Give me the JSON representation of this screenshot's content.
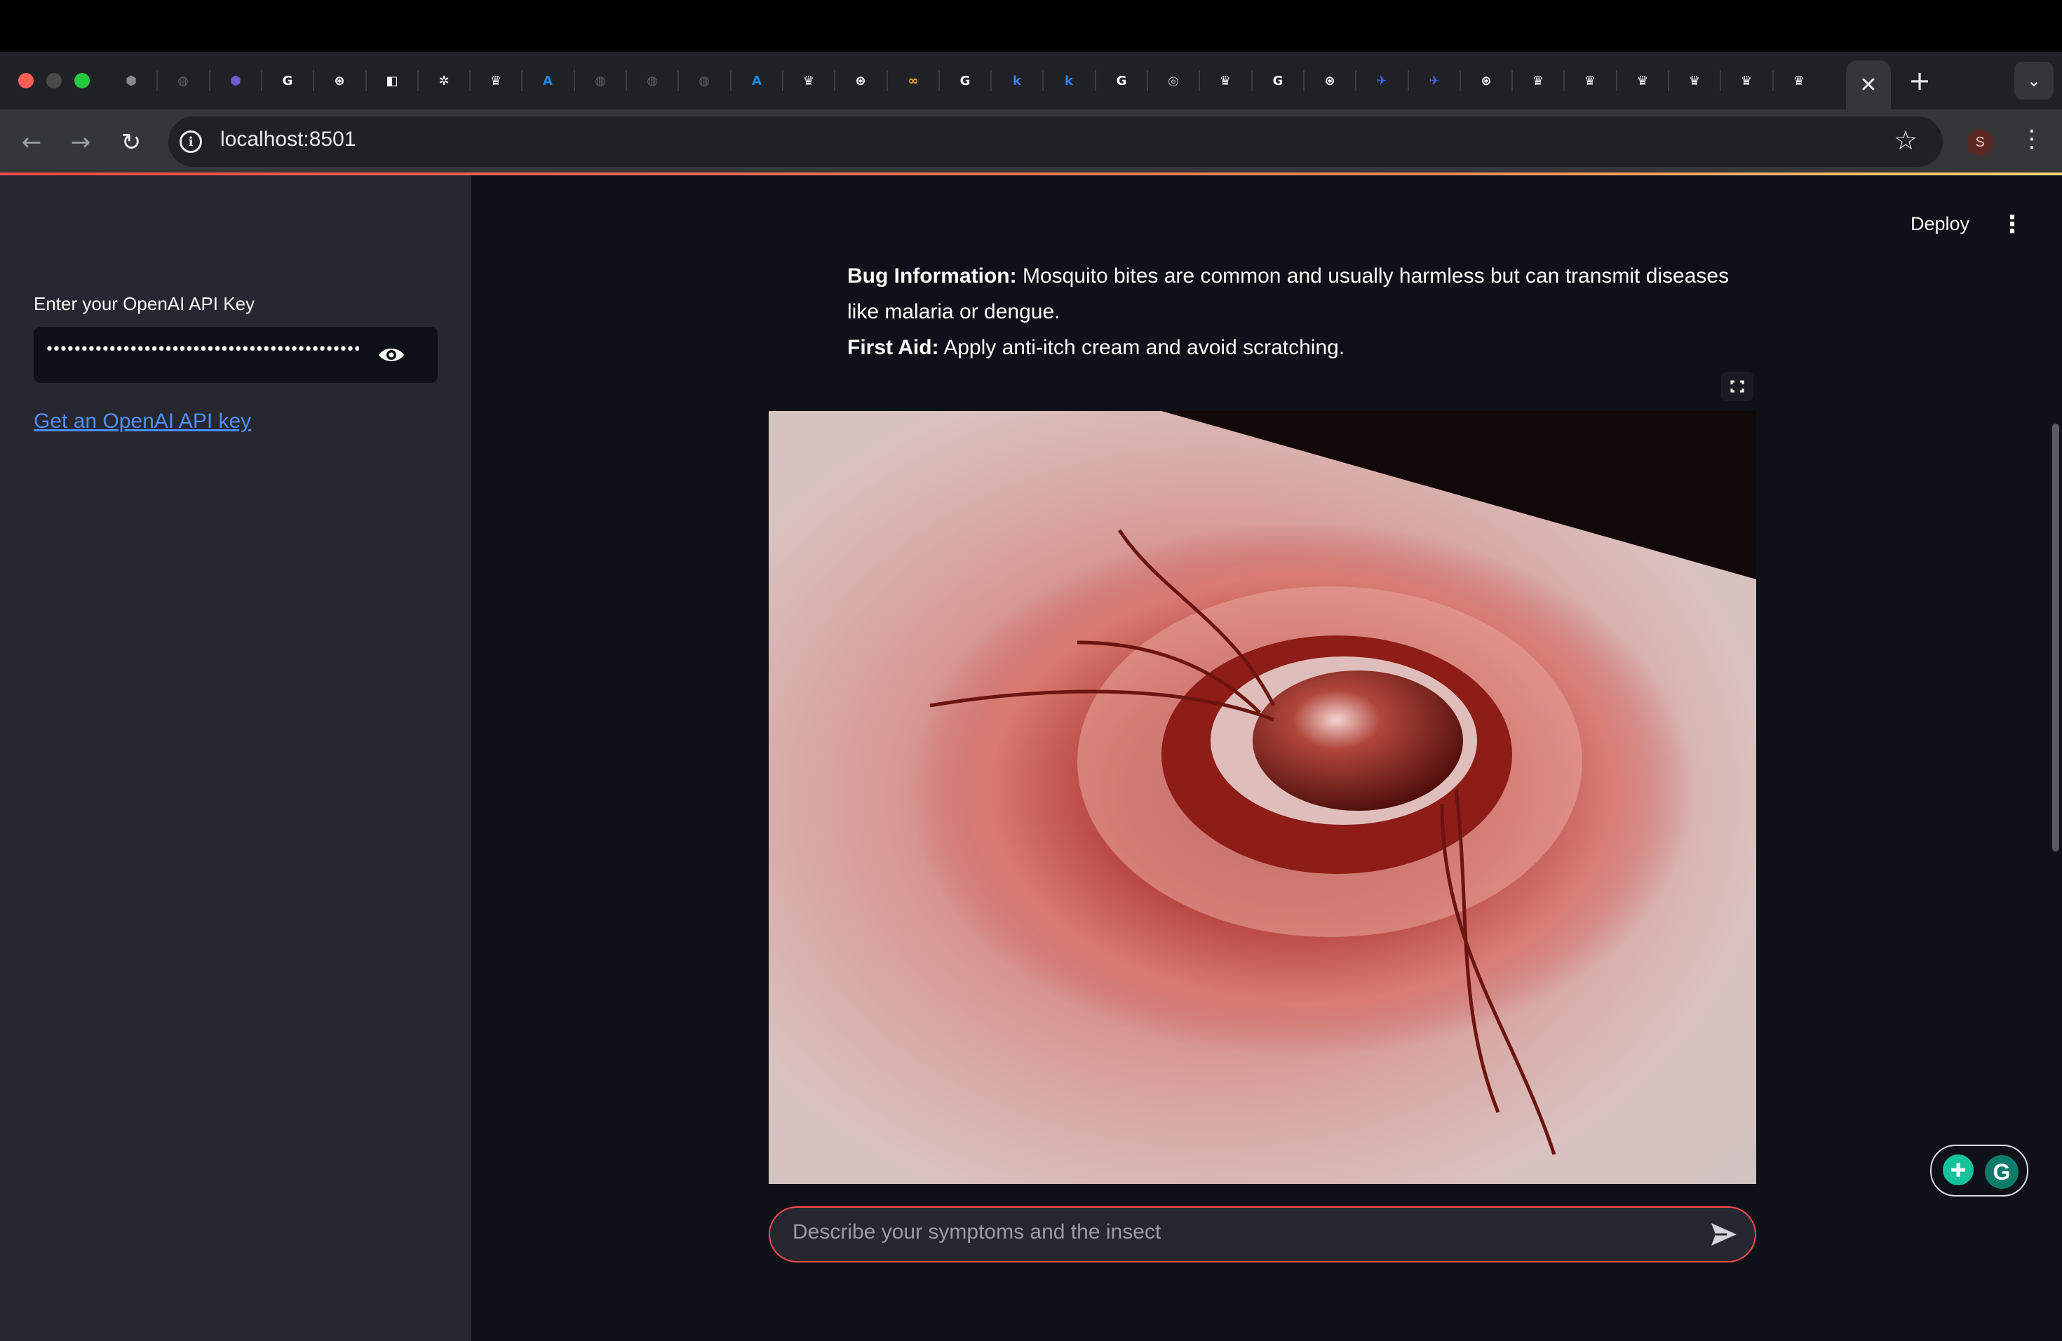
{
  "browser": {
    "url": "localhost:8501",
    "active_tab_close": "✕",
    "new_tab": "+",
    "tab_menu": "⌄",
    "profile_initial": "S",
    "back": "←",
    "forward": "→",
    "reload": "↻",
    "info": "i",
    "star": "☆",
    "menu": "⋮",
    "tabs": [
      {
        "icon": "hub-icon",
        "glyph": "⬢",
        "color": "#8a8a8a"
      },
      {
        "icon": "globe-icon",
        "glyph": "◍",
        "color": "#5f6368"
      },
      {
        "icon": "shield-icon",
        "glyph": "⬢",
        "color": "#6d5bd0"
      },
      {
        "icon": "google-icon",
        "glyph": "G",
        "color": "#ffffff"
      },
      {
        "icon": "openai-icon",
        "glyph": "⊛",
        "color": "#ffffff"
      },
      {
        "icon": "notion-icon",
        "glyph": "◧",
        "color": "#ffffff"
      },
      {
        "icon": "bug-icon",
        "glyph": "✲",
        "color": "#ffffff"
      },
      {
        "icon": "emblem-icon",
        "glyph": "♛",
        "color": "#ffffff"
      },
      {
        "icon": "a-icon",
        "glyph": "A",
        "color": "#1e88e5"
      },
      {
        "icon": "globe-icon",
        "glyph": "◍",
        "color": "#5f6368"
      },
      {
        "icon": "globe-icon",
        "glyph": "◍",
        "color": "#5f6368"
      },
      {
        "icon": "globe-icon",
        "glyph": "◍",
        "color": "#5f6368"
      },
      {
        "icon": "a-icon",
        "glyph": "A",
        "color": "#1e88e5"
      },
      {
        "icon": "crown-icon",
        "glyph": "♛",
        "color": "#ffffff"
      },
      {
        "icon": "openai-icon",
        "glyph": "⊛",
        "color": "#ffffff"
      },
      {
        "icon": "infinity-icon",
        "glyph": "∞",
        "color": "#f5a623"
      },
      {
        "icon": "google-icon",
        "glyph": "G",
        "color": "#ffffff"
      },
      {
        "icon": "k-icon",
        "glyph": "k",
        "color": "#2f80ed"
      },
      {
        "icon": "k-icon",
        "glyph": "k",
        "color": "#2f80ed"
      },
      {
        "icon": "google-icon",
        "glyph": "G",
        "color": "#ffffff"
      },
      {
        "icon": "chrome-icon",
        "glyph": "◎",
        "color": "#bdbdbd"
      },
      {
        "icon": "crown-icon",
        "glyph": "♛",
        "color": "#ffffff"
      },
      {
        "icon": "google-icon",
        "glyph": "G",
        "color": "#ffffff"
      },
      {
        "icon": "openai-icon",
        "glyph": "⊛",
        "color": "#ffffff"
      },
      {
        "icon": "whale-icon",
        "glyph": "✈",
        "color": "#4466ff"
      },
      {
        "icon": "whale-icon",
        "glyph": "✈",
        "color": "#4466ff"
      },
      {
        "icon": "openai-icon",
        "glyph": "⊛",
        "color": "#ffffff"
      },
      {
        "icon": "crown-icon",
        "glyph": "♛",
        "color": "#ffffff"
      },
      {
        "icon": "crown-icon",
        "glyph": "♛",
        "color": "#ffffff"
      },
      {
        "icon": "crown-icon",
        "glyph": "♛",
        "color": "#ffffff"
      },
      {
        "icon": "crown-icon",
        "glyph": "♛",
        "color": "#ffffff"
      },
      {
        "icon": "crown-icon",
        "glyph": "♛",
        "color": "#ffffff"
      },
      {
        "icon": "crown-icon",
        "glyph": "♛",
        "color": "#ffffff"
      }
    ]
  },
  "sidebar": {
    "api_key_label": "Enter your OpenAI API Key",
    "api_key_value": "•••••••••••••••••••••••••••••••••••••••••••••••••••••••",
    "api_key_link": "Get an OpenAI API key"
  },
  "header": {
    "deploy_label": "Deploy",
    "menu_glyph": "⋮"
  },
  "message": {
    "bug_info_label": "Bug Information:",
    "bug_info_line1": " Mosquito bites are common and usually harmless but can transmit diseases",
    "bug_info_line2": "like malaria or dengue.",
    "first_aid_label": "First Aid:",
    "first_aid_text": " Apply anti-itch cream and avoid scratching."
  },
  "chat": {
    "placeholder": "Describe your symptoms and the insect"
  },
  "colors": {
    "accent": "#ff4b4b",
    "link": "#4f8ff7",
    "sidebar_bg": "#262730",
    "main_bg": "#0e1117"
  }
}
